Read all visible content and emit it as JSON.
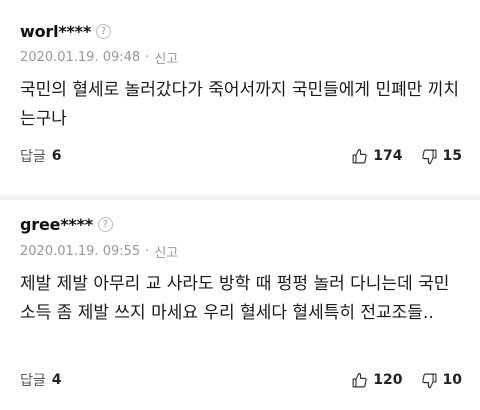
{
  "comments": [
    {
      "author": "worl****",
      "date": "2020.01.19. 09:48",
      "report_label": "신고",
      "text": "국민의 혈세로 놀러갔다가 죽어서까지 국민들에게 민폐만 끼치는구나",
      "reply_label": "답글",
      "reply_count": "6",
      "likes": "174",
      "dislikes": "15"
    },
    {
      "author": "gree****",
      "date": "2020.01.19. 09:55",
      "report_label": "신고",
      "text": "제발 제발 아무리 교 사라도 방학 때 펑펑 놀러 다니는데 국민소득 좀 제발 쓰지 마세요 우리 혈세다 혈세특히 전교조들..",
      "reply_label": "답글",
      "reply_count": "4",
      "likes": "120",
      "dislikes": "10"
    }
  ],
  "icons": {
    "help": "help-circle-icon",
    "like": "thumbs-up-icon",
    "dislike": "thumbs-down-icon"
  }
}
